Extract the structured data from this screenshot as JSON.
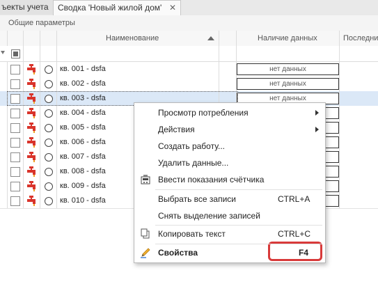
{
  "tabs": [
    {
      "label": "ъекты учета"
    },
    {
      "label": "Сводка 'Новый жилой дом'",
      "close": "✕"
    }
  ],
  "group_header": "Общие параметры",
  "columns": {
    "name": "Наименование",
    "data_presence": "Наличие данных",
    "last": "Последни"
  },
  "rows": [
    {
      "name": "кв. 001 - dsfa",
      "data": "нет данных"
    },
    {
      "name": "кв. 002 - dsfa",
      "data": "нет данных"
    },
    {
      "name": "кв. 003 - dsfa",
      "data": "нет данных"
    },
    {
      "name": "кв. 004 - dsfa",
      "data": ""
    },
    {
      "name": "кв. 005 - dsfa",
      "data": ""
    },
    {
      "name": "кв. 006 - dsfa",
      "data": ""
    },
    {
      "name": "кв. 007 - dsfa",
      "data": ""
    },
    {
      "name": "кв. 008 - dsfa",
      "data": ""
    },
    {
      "name": "кв. 009 - dsfa",
      "data": ""
    },
    {
      "name": "кв. 010 - dsfa",
      "data": ""
    }
  ],
  "context_menu": {
    "items": [
      {
        "label": "Просмотр потребления",
        "submenu": true
      },
      {
        "label": "Действия",
        "submenu": true
      },
      {
        "label": "Создать работу..."
      },
      {
        "label": "Удалить данные..."
      },
      {
        "label": "Ввести показания счётчика",
        "icon": "meter-icon"
      },
      {
        "label": "Выбрать все записи",
        "shortcut": "CTRL+A"
      },
      {
        "label": "Снять выделение записей"
      },
      {
        "label": "Копировать текст",
        "shortcut": "CTRL+C",
        "icon": "copy-icon"
      },
      {
        "label": "Свойства",
        "shortcut": "F4",
        "icon": "pencil-icon"
      }
    ]
  },
  "colors": {
    "selected_row": "#dbe8f7",
    "highlight_border": "#d83a3a",
    "tap_red": "#d9342b",
    "tap_orange": "#f0a020"
  }
}
